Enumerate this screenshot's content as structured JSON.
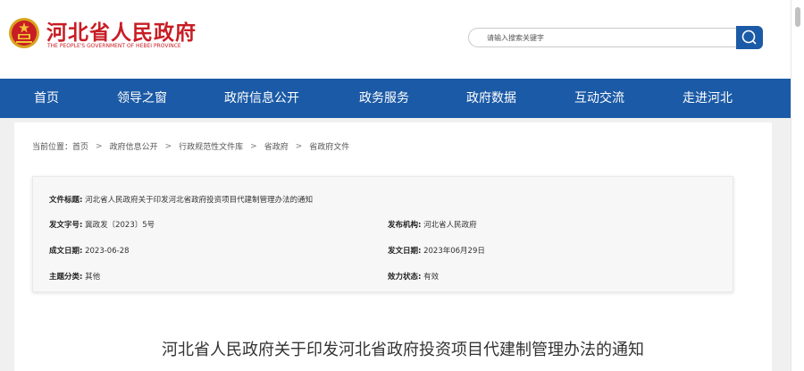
{
  "header": {
    "site_name": "河北省人民政府",
    "site_subtitle": "THE PEOPLE'S GOVERNMENT OF HEBEI PROVINCE",
    "search_placeholder": "请输入搜索关键字"
  },
  "nav": {
    "items": [
      "首页",
      "领导之窗",
      "政府信息公开",
      "政务服务",
      "政府数据",
      "互动交流",
      "走进河北"
    ]
  },
  "breadcrumb": {
    "prefix": "当前位置：",
    "items": [
      "首页",
      "政府信息公开",
      "行政规范性文件库",
      "省政府",
      "省政府文件"
    ],
    "separator": ">"
  },
  "meta": {
    "title_label": "文件标题:",
    "title_value": "河北省人民政府关于印发河北省政府投资项目代建制管理办法的通知",
    "doc_no_label": "发文字号:",
    "doc_no_value": "冀政发〔2023〕5号",
    "issuer_label": "发布机构:",
    "issuer_value": "河北省人民政府",
    "created_label": "成文日期:",
    "created_value": "2023-06-28",
    "published_label": "发文日期:",
    "published_value": "2023年06月29日",
    "topic_label": "主题分类:",
    "topic_value": "其他",
    "status_label": "效力状态:",
    "status_value": "有效"
  },
  "document": {
    "title": "河北省人民政府关于印发河北省政府投资项目代建制管理办法的通知"
  },
  "colors": {
    "brand_red": "#c81d24",
    "nav_blue": "#1b5aa6"
  }
}
